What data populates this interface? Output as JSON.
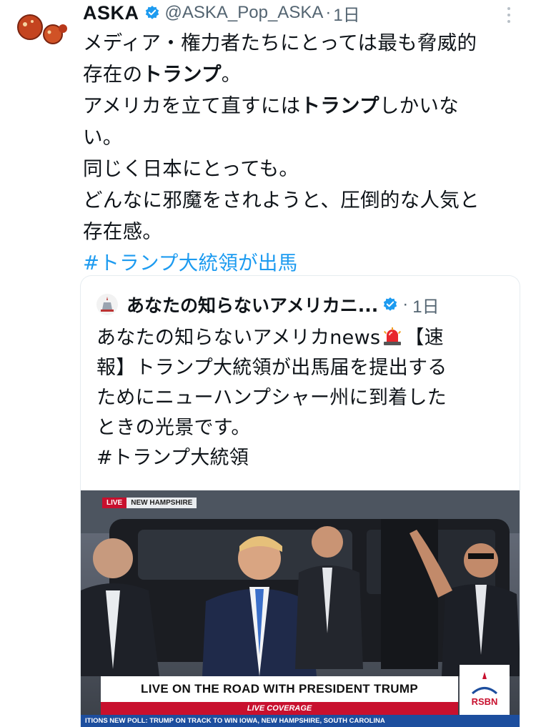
{
  "tweet": {
    "author_name": "ASKA",
    "author_handle": "@ASKA_Pop_ASKA",
    "separator": "·",
    "time": "1日",
    "lines": [
      {
        "pre": "メディア・権力者たちにとっては最も脅威的",
        "bold": "",
        "post": ""
      },
      {
        "pre": "存在の",
        "bold": "トランプ",
        "post": "。"
      },
      {
        "pre": "アメリカを立て直すには",
        "bold": "トランプ",
        "post": "しかいな"
      },
      {
        "pre": "い。",
        "bold": "",
        "post": ""
      },
      {
        "pre": "同じく日本にとっても。",
        "bold": "",
        "post": ""
      },
      {
        "pre": "どんなに邪魔をされようと、圧倒的な人気と",
        "bold": "",
        "post": ""
      },
      {
        "pre": "存在感。",
        "bold": "",
        "post": ""
      }
    ],
    "hashtag": "#トランプ大統領が出馬"
  },
  "quote": {
    "account_name": "あなたの知らないアメリカニ...",
    "separator": "·",
    "time": "1日",
    "line1_pre": "あなたの知らないアメリカnews",
    "line1_post": "【速",
    "lines": [
      "報】トランプ大統領が出馬届を提出する",
      "ためにニューハンプシャー州に到着した",
      "ときの光景です。",
      "#トランプ大統領"
    ]
  },
  "media": {
    "live_label": "LIVE",
    "location_label": "NEW HAMPSHIRE",
    "banner_text": "LIVE ON THE ROAD WITH PRESIDENT TRUMP",
    "sub_banner": "LIVE COVERAGE",
    "ticker": "ITIONS   NEW POLL: TRUMP ON TRACK TO WIN IOWA, NEW HAMPSHIRE, SOUTH CAROLINA",
    "network_logo": "RSBN"
  },
  "icons": {
    "verified": "verified-badge-icon",
    "more": "more-options-icon",
    "siren": "siren-emoji-icon"
  },
  "colors": {
    "accent": "#1d9bf0",
    "text": "#0f1419",
    "muted": "#536471",
    "live_red": "#c8102e",
    "ticker_blue": "#1d4e9e"
  }
}
